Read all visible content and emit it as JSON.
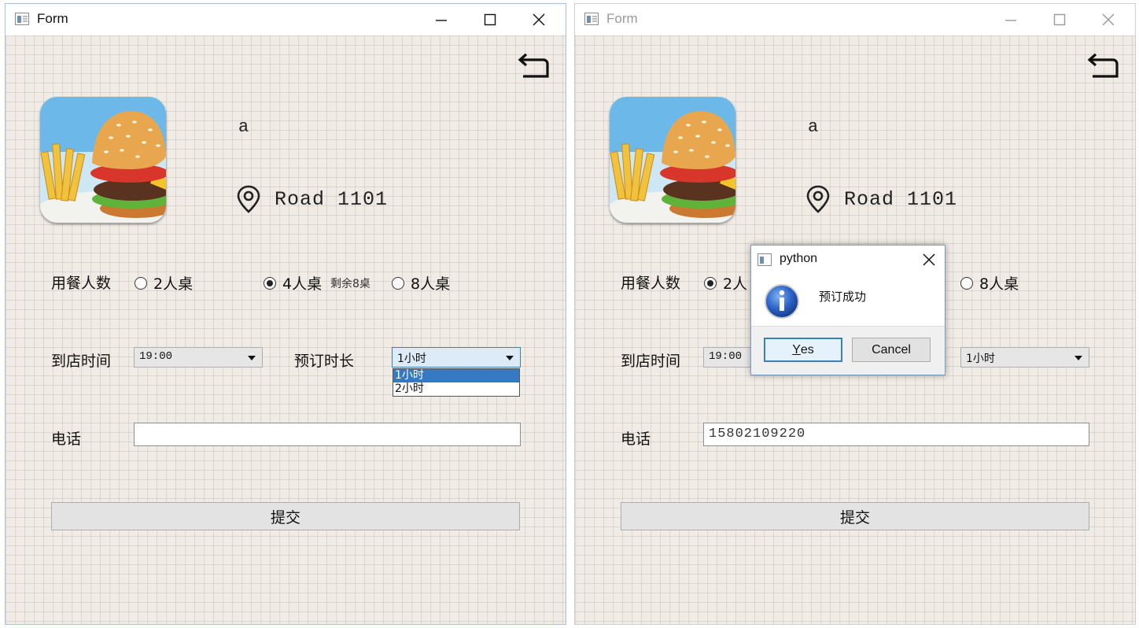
{
  "left_window": {
    "title": "Form",
    "restaurant_name": "a",
    "address": "Road 1101",
    "party_size_label": "用餐人数",
    "options": [
      {
        "label": "2人桌",
        "selected": false
      },
      {
        "label": "4人桌",
        "selected": true,
        "remaining": "剩余8桌"
      },
      {
        "label": "8人桌",
        "selected": false
      }
    ],
    "arrival_label": "到店时间",
    "arrival_value": "19:00",
    "duration_label": "预订时长",
    "duration_value": "1小时",
    "duration_options": [
      "1小时",
      "2小时"
    ],
    "phone_label": "电话",
    "phone_value": "",
    "submit_label": "提交"
  },
  "right_window": {
    "title": "Form",
    "restaurant_name": "a",
    "address": "Road 1101",
    "party_size_label": "用餐人数",
    "option_2": "2人",
    "option_8": "8人桌",
    "arrival_label": "到店时间",
    "arrival_value": "19:00",
    "duration_value": "1小时",
    "phone_label": "电话",
    "phone_value": "15802109220",
    "submit_label": "提交"
  },
  "dialog": {
    "title": "python",
    "message": "预订成功",
    "yes_mnemonic": "Y",
    "yes_rest": "es",
    "cancel_label": "Cancel"
  },
  "icons": {
    "back": "back-arrow-icon",
    "location": "location-pin-icon",
    "info": "info-icon",
    "logo": "burger-logo"
  }
}
